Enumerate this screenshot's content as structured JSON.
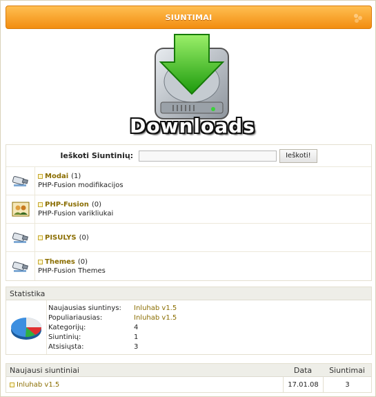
{
  "title_bar": {
    "label": "SIUNTIMAI"
  },
  "logo": {
    "text": "Downloads"
  },
  "search": {
    "label": "Ieškoti Siuntinių:",
    "value": "",
    "button_label": "Ieškoti!"
  },
  "categories": [
    {
      "name": "Modai",
      "count": "(1)",
      "description": "PHP-Fusion modifikacijos",
      "icon": "usb-drive-icon"
    },
    {
      "name": "PHP-Fusion",
      "count": "(0)",
      "description": "PHP-Fusion varikliukai",
      "icon": "users-group-icon"
    },
    {
      "name": "PISULYS",
      "count": "(0)",
      "description": "",
      "icon": "usb-drive-icon"
    },
    {
      "name": "Themes",
      "count": "(0)",
      "description": "PHP-Fusion Themes",
      "icon": "usb-drive-icon"
    }
  ],
  "stats": {
    "heading": "Statistika",
    "rows": [
      {
        "label": "Naujausias siuntinys:",
        "value": "Inluhab v1.5",
        "is_link": true
      },
      {
        "label": "Populiariausias:",
        "value": "Inluhab v1.5",
        "is_link": true
      },
      {
        "label": "Kategorijų:",
        "value": "4",
        "is_link": false
      },
      {
        "label": "Siuntinių:",
        "value": "1",
        "is_link": false
      },
      {
        "label": "Atsisiųsta:",
        "value": "3",
        "is_link": false
      }
    ]
  },
  "latest": {
    "heading": "Naujausi siuntiniai",
    "col_date": "Data",
    "col_count": "Siuntimai",
    "rows": [
      {
        "title": "Inluhab v1.5",
        "date": "17.01.08",
        "count": "3"
      }
    ]
  },
  "colors": {
    "accent": "#f28d10",
    "link": "#8a6d00",
    "header_bg": "#eeeee8"
  }
}
